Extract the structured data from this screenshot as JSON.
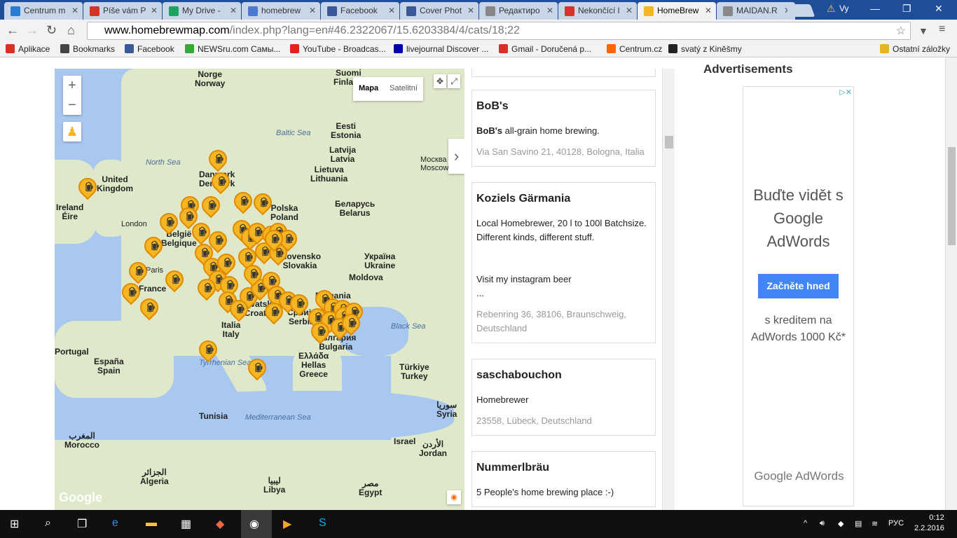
{
  "browser": {
    "tabs": [
      {
        "label": "Centrum m",
        "color": "#2b7bd4"
      },
      {
        "label": "Píše vám P",
        "color": "#d93025"
      },
      {
        "label": "My Drive -",
        "color": "#1ea362"
      },
      {
        "label": "homebrew",
        "color": "#4a7bd0"
      },
      {
        "label": "Facebook",
        "color": "#3b5998"
      },
      {
        "label": "Cover Phot",
        "color": "#3b5998"
      },
      {
        "label": "Редактиро",
        "color": "#888888"
      },
      {
        "label": "Nekončící l",
        "color": "#d9302a"
      },
      {
        "label": "HomeBrew",
        "color": "#f5b623"
      },
      {
        "label": "MAIDAN.R",
        "color": "#888888"
      }
    ],
    "user_label": "Vy",
    "url_host": "www.homebrewmap.com",
    "url_rest": "/index.php?lang=en#46.2322067/15.6203384/4/cats/18;22"
  },
  "bookmarks": [
    {
      "label": "Aplikace",
      "color": "#d93025"
    },
    {
      "label": "Bookmarks",
      "color": "#444444"
    },
    {
      "label": "Facebook",
      "color": "#3b5998"
    },
    {
      "label": "NEWSru.com Самы...",
      "color": "#3a3"
    },
    {
      "label": "YouTube - Broadcas...",
      "color": "#e62117"
    },
    {
      "label": "livejournal Discover ...",
      "color": "#00a"
    },
    {
      "label": "Gmail - Doručená p...",
      "color": "#d93025"
    },
    {
      "label": "Centrum.cz",
      "color": "#f60"
    },
    {
      "label": "svatý z Kiněšmy",
      "color": "#222222"
    },
    {
      "label": "Ostatní záložky",
      "color": "#e6b422"
    }
  ],
  "map": {
    "type_buttons": [
      "Mapa",
      "Satelitní"
    ],
    "countries": [
      {
        "label": "Norge\nNorway"
      },
      {
        "label": "Suomi\nFinland"
      },
      {
        "label": "Eesti\nEstonia"
      },
      {
        "label": "Latvija\nLatvia"
      },
      {
        "label": "Lietuva\nLithuania"
      },
      {
        "label": "Danmark\nDenmark"
      },
      {
        "label": "United\nKingdom"
      },
      {
        "label": "Ireland\nÉire"
      },
      {
        "label": "Polska\nPoland"
      },
      {
        "label": "Беларусь\nBelarus"
      },
      {
        "label": "Україна\nUkraine"
      },
      {
        "label": "Moldova"
      },
      {
        "label": "France"
      },
      {
        "label": "België\nBelgique"
      },
      {
        "label": "Slovensko\nSlovakia"
      },
      {
        "label": "Hrvatska\nCroatia"
      },
      {
        "label": "Italia\nItaly"
      },
      {
        "label": "Србија\nSerbia"
      },
      {
        "label": "България\nBulgaria"
      },
      {
        "label": "Ελλάδα\nHellas\nGreece"
      },
      {
        "label": "Türkiye\nTurkey"
      },
      {
        "label": "España\nSpain"
      },
      {
        "label": "Portugal"
      },
      {
        "label": "Tunisia"
      },
      {
        "label": "المغرب\nMorocco"
      },
      {
        "label": "الجزائر\nAlgeria"
      },
      {
        "label": "ليبيا\nLibya"
      },
      {
        "label": "مصر\nEgypt"
      },
      {
        "label": "سوريا\nSyria"
      },
      {
        "label": "Israel"
      },
      {
        "label": "الأردن\nJordan"
      },
      {
        "label": "Romania"
      }
    ],
    "seas": [
      {
        "label": "North Sea"
      },
      {
        "label": "Baltic Sea"
      },
      {
        "label": "Black Sea"
      },
      {
        "label": "Mediterranean Sea"
      },
      {
        "label": "Tyrrhenian Sea"
      }
    ],
    "cities": [
      {
        "label": "London"
      },
      {
        "label": "Paris"
      },
      {
        "label": "Москва\nMoscow"
      }
    ],
    "google_logo": "Google"
  },
  "listing": [
    {
      "name": "BoB's",
      "desc_bold": "BoB's",
      "desc": " all-grain home brewing.",
      "address": "Via San Savino 21, 40128, Bologna, Italia"
    },
    {
      "name": "Koziels Gärmania",
      "desc_bold": "",
      "desc": "Local Homebrewer, 20 l to 100l Batchsize. Different kinds, different stuff.\n\n\nVisit my instagram beer\n...",
      "address": "Rebenring 36, 38106, Braunschweig, Deutschland"
    },
    {
      "name": "saschabouchon",
      "desc_bold": "",
      "desc": "Homebrewer",
      "address": "23558, Lübeck, Deutschland"
    },
    {
      "name": "Nummerlbräu",
      "desc_bold": "",
      "desc": "5 People's home brewing place :-)",
      "address": ""
    }
  ],
  "ads": {
    "title": "Advertisements",
    "headline": "Buďte vidět s Google AdWords",
    "button": "Začněte hned",
    "sub": "s kreditem na AdWords 1000 Kč*",
    "brand": "Google AdWords"
  },
  "taskbar": {
    "lang": "РУС",
    "time": "0:12",
    "date": "2.2.2016"
  }
}
